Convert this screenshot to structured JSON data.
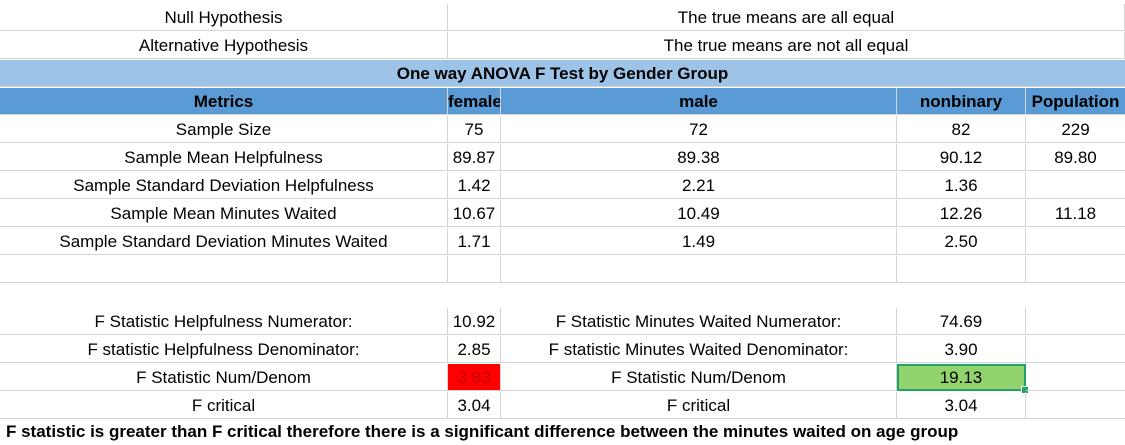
{
  "hypotheses": {
    "null_label": "Null Hypothesis",
    "null_value": "The true means are all equal",
    "alt_label": "Alternative Hypothesis",
    "alt_value": "The true means are not all equal"
  },
  "title": "One way ANOVA F Test by Gender Group",
  "columns": {
    "metrics": "Metrics",
    "female": "female",
    "male": "male",
    "nonbinary": "nonbinary",
    "population": "Population"
  },
  "rows": [
    {
      "label": "Sample Size",
      "female": "75",
      "male": "72",
      "nonbinary": "82",
      "population": "229"
    },
    {
      "label": "Sample Mean Helpfulness",
      "female": "89.87",
      "male": "89.38",
      "nonbinary": "90.12",
      "population": "89.80"
    },
    {
      "label": "Sample Standard Deviation Helpfulness",
      "female": "1.42",
      "male": "2.21",
      "nonbinary": "1.36",
      "population": ""
    },
    {
      "label": "Sample Mean Minutes Waited",
      "female": "10.67",
      "male": "10.49",
      "nonbinary": "12.26",
      "population": "11.18"
    },
    {
      "label": "Sample Standard Deviation Minutes Waited",
      "female": "1.71",
      "male": "1.49",
      "nonbinary": "2.50",
      "population": ""
    }
  ],
  "fstats": {
    "help_num_label": "F Statistic Helpfulness Numerator:",
    "help_num": "10.92",
    "mw_num_label": "F Statistic Minutes Waited Numerator:",
    "mw_num": "74.69",
    "help_den_label": "F statistic Helpfulness Denominator:",
    "help_den": "2.85",
    "mw_den_label": "F statistic Minutes Waited Denominator:",
    "mw_den": "3.90",
    "help_ratio_label": "F Statistic Num/Denom",
    "help_ratio": "3.83",
    "mw_ratio_label": "F Statistic Num/Denom",
    "mw_ratio": "19.13",
    "help_crit_label": "F critical",
    "help_crit": "3.04",
    "mw_crit_label": "F critical",
    "mw_crit": "3.04"
  },
  "conclusion": "F statistic is greater than F critical therefore there is a significant difference between the minutes waited on age group",
  "colors": {
    "banner": "#9dc3e6",
    "header": "#5b9bd5",
    "fail": "#ff0000",
    "pass": "#92d36e"
  }
}
